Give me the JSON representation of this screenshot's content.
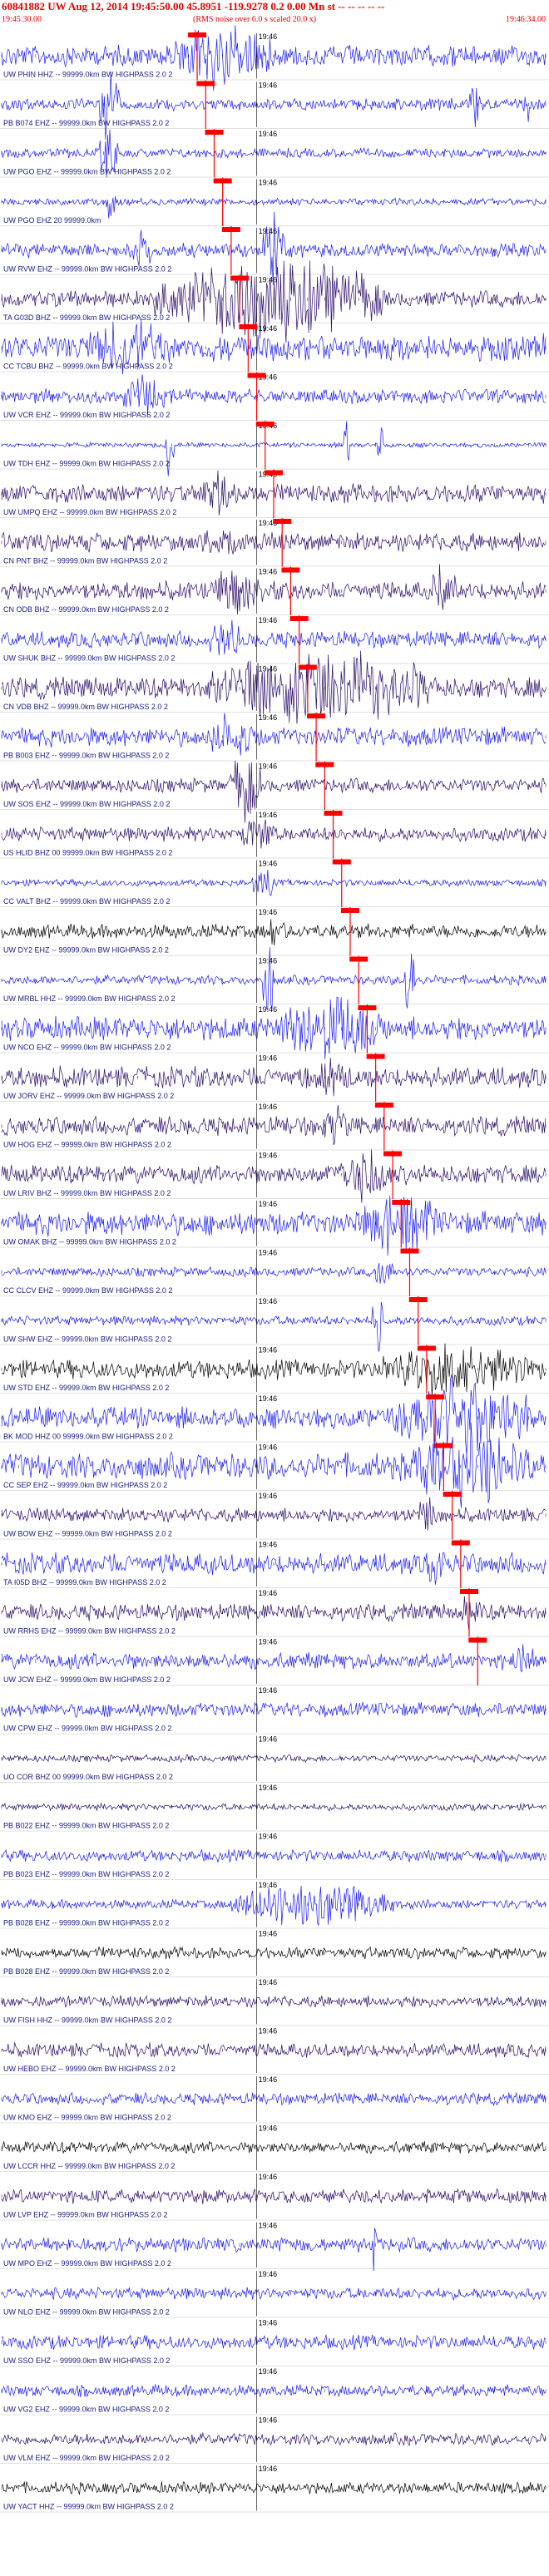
{
  "header": {
    "title": "60841882 UW Aug 12, 2014 19:45:50.00   45.8951 -119.9278  0.2 0.00 Mn st -- -- -- -- --",
    "start_time": "19:45:30.00",
    "scale_note": "(RMS noise over 6.0 s scaled 20.0 x)",
    "end_time": "19:46:34.00"
  },
  "colors": {
    "trace_blue": "#1a1aff",
    "trace_purple": "#2a0a6a",
    "trace_black": "#000000",
    "pick_red": "#ff0000",
    "label_dark": "#1a1a80"
  },
  "chart_data": {
    "type": "seismogram",
    "title": "60841882 UW Aug 12, 2014 19:45:50.00",
    "time_range": [
      "19:45:30.00",
      "19:46:34.00"
    ],
    "minute_tick_label": "19:46",
    "channels": [
      {
        "label": "UW PHIN HHZ -- 99999.0km BW  HIGHPASS  2.0  2",
        "color": "blue",
        "pick": "19:45:53",
        "amp": 0.45,
        "burst": [
          0.3,
          0.5,
          1.8
        ],
        "extra": []
      },
      {
        "label": "PB B074 EHZ -- 99999.0km BW  HIGHPASS  2.0  2",
        "color": "blue",
        "pick": "19:45:54",
        "amp": 0.25,
        "burst": [
          0.18,
          0.22,
          2.2
        ],
        "extra": [
          [
            0.86,
            0.88,
            2.0
          ],
          [
            0.96,
            0.97,
            1.6
          ]
        ]
      },
      {
        "label": "UW PGO EHZ -- 99999.0km BW  HIGHPASS  2.0  2",
        "color": "blue",
        "pick": "19:45:55",
        "amp": 0.2,
        "burst": [
          0.18,
          0.22,
          1.6
        ],
        "extra": []
      },
      {
        "label": "UW PGO EHZ 20 99999.0km",
        "color": "blue",
        "pick": "19:45:56",
        "amp": 0.15,
        "burst": [
          0.19,
          0.21,
          1.2
        ],
        "extra": []
      },
      {
        "label": "UW RVW EHZ -- 99999.0km BW  HIGHPASS  2.0  2",
        "color": "blue",
        "pick": "19:45:57",
        "amp": 0.3,
        "burst": [
          0.24,
          0.28,
          1.5
        ],
        "extra": [
          [
            0.48,
            0.52,
            2.0
          ]
        ]
      },
      {
        "label": "TA G03D BHZ -- 99999.0km BW  HIGHPASS  2.0  2",
        "color": "purple",
        "pick": "19:45:58",
        "amp": 0.35,
        "burst": [
          0.28,
          0.7,
          2.4
        ],
        "extra": []
      },
      {
        "label": "CC TCBU BHZ -- 99999.0km BW  HIGHPASS  2.0  2",
        "color": "blue",
        "pick": "19:45:59",
        "amp": 0.55,
        "burst": [
          0.15,
          0.32,
          1.6
        ],
        "extra": []
      },
      {
        "label": "UW VCR EHZ -- 99999.0km BW  HIGHPASS  2.0  2",
        "color": "blue",
        "pick": "19:46:00",
        "amp": 0.3,
        "burst": [
          0.22,
          0.3,
          1.2
        ],
        "extra": []
      },
      {
        "label": "UW TDH EHZ -- 99999.0km BW  HIGHPASS  2.0  2",
        "color": "blue",
        "pick": "19:46:01",
        "amp": 0.1,
        "burst": [
          0.3,
          0.32,
          2.5
        ],
        "extra": [
          [
            0.63,
            0.64,
            2.5
          ],
          [
            0.69,
            0.7,
            2.0
          ]
        ]
      },
      {
        "label": "UW UMPQ EHZ -- 99999.0km BW  HIGHPASS  2.0  2",
        "color": "purple",
        "pick": "19:46:02",
        "amp": 0.4,
        "burst": [
          0.36,
          0.44,
          1.2
        ],
        "extra": []
      },
      {
        "label": "CN PNT BHZ -- 99999.0km BW  HIGHPASS  2.0  2",
        "color": "purple",
        "pick": "19:46:03",
        "amp": 0.4,
        "burst": [
          0.36,
          0.46,
          1.2
        ],
        "extra": []
      },
      {
        "label": "CN ODB BHZ -- 99999.0km BW  HIGHPASS  2.0  2",
        "color": "purple",
        "pick": "19:46:04",
        "amp": 0.4,
        "burst": [
          0.38,
          0.48,
          1.4
        ],
        "extra": [
          [
            0.78,
            0.84,
            1.4
          ]
        ]
      },
      {
        "label": "UW SHUK BHZ -- 99999.0km BW  HIGHPASS  2.0  2",
        "color": "blue",
        "pick": "19:46:05",
        "amp": 0.35,
        "burst": [
          0.38,
          0.44,
          1.3
        ],
        "extra": []
      },
      {
        "label": "CN VDB BHZ -- 99999.0km BW  HIGHPASS  2.0  2",
        "color": "purple",
        "pick": "19:46:06",
        "amp": 0.45,
        "burst": [
          0.38,
          0.8,
          2.2
        ],
        "extra": []
      },
      {
        "label": "PB B003 EHZ -- 99999.0km BW  HIGHPASS  2.0  2",
        "color": "blue",
        "pick": "19:46:07",
        "amp": 0.4,
        "burst": [
          0.38,
          0.46,
          1.4
        ],
        "extra": []
      },
      {
        "label": "UW SOS EHZ -- 99999.0km BW  HIGHPASS  2.0  2",
        "color": "purple",
        "pick": "19:46:08",
        "amp": 0.3,
        "burst": [
          0.42,
          0.48,
          2.0
        ],
        "extra": []
      },
      {
        "label": "US HLID BHZ 00 99999.0km BW  HIGHPASS  2.0  2",
        "color": "purple",
        "pick": "19:46:09",
        "amp": 0.3,
        "burst": [
          0.44,
          0.5,
          1.2
        ],
        "extra": []
      },
      {
        "label": "CC VALT BHZ -- 99999.0km BW  HIGHPASS  2.0  2",
        "color": "blue",
        "pick": "19:46:10",
        "amp": 0.15,
        "burst": [
          0.46,
          0.5,
          1.0
        ],
        "extra": []
      },
      {
        "label": "UW DY2 EHZ -- 99999.0km BW  HIGHPASS  2.0  2",
        "color": "black",
        "pick": "19:46:11",
        "amp": 0.3,
        "burst": [
          0.48,
          0.52,
          1.2
        ],
        "extra": []
      },
      {
        "label": "UW MRBL HHZ -- 99999.0km BW  HIGHPASS  2.0  2",
        "color": "blue",
        "pick": "19:46:12",
        "amp": 0.2,
        "burst": [
          0.48,
          0.5,
          2.4
        ],
        "extra": [
          [
            0.74,
            0.76,
            2.4
          ]
        ]
      },
      {
        "label": "UW NCO EHZ -- 99999.0km BW  HIGHPASS  2.0  2",
        "color": "blue",
        "pick": "19:46:13",
        "amp": 0.5,
        "burst": [
          0.5,
          0.7,
          2.0
        ],
        "extra": []
      },
      {
        "label": "UW JORV EHZ -- 99999.0km BW  HIGHPASS  2.0  2",
        "color": "purple",
        "pick": "19:46:14",
        "amp": 0.45,
        "burst": [
          0.56,
          0.64,
          1.2
        ],
        "extra": []
      },
      {
        "label": "UW HOG EHZ -- 99999.0km BW  HIGHPASS  2.0  2",
        "color": "purple",
        "pick": "19:46:15",
        "amp": 0.4,
        "burst": [
          0.58,
          0.64,
          1.2
        ],
        "extra": []
      },
      {
        "label": "UW LRIV BHZ -- 99999.0km BW  HIGHPASS  2.0  2",
        "color": "purple",
        "pick": "19:46:16",
        "amp": 0.4,
        "burst": [
          0.6,
          0.72,
          1.6
        ],
        "extra": []
      },
      {
        "label": "UW OMAK BHZ -- 99999.0km BW  HIGHPASS  2.0  2",
        "color": "blue",
        "pick": "19:46:17",
        "amp": 0.5,
        "burst": [
          0.66,
          0.8,
          2.0
        ],
        "extra": []
      },
      {
        "label": "CC CLCV EHZ -- 99999.0km BW  HIGHPASS  2.0  2",
        "color": "blue",
        "pick": "19:46:18",
        "amp": 0.2,
        "burst": [
          0.68,
          0.72,
          1.0
        ],
        "extra": []
      },
      {
        "label": "UW SHW EHZ -- 99999.0km BW  HIGHPASS  2.0  2",
        "color": "blue",
        "pick": "19:46:19",
        "amp": 0.2,
        "burst": [
          0.68,
          0.7,
          2.0
        ],
        "extra": []
      },
      {
        "label": "UW STD EHZ -- 99999.0km BW  HIGHPASS  2.0  2",
        "color": "black",
        "pick": "19:46:20",
        "amp": 0.4,
        "burst": [
          0.7,
          0.98,
          1.6
        ],
        "extra": []
      },
      {
        "label": "BK MOD HHZ 00 99999.0km BW  HIGHPASS  2.0  2",
        "color": "blue",
        "pick": "19:46:21",
        "amp": 0.45,
        "burst": [
          0.72,
          0.98,
          2.4
        ],
        "extra": []
      },
      {
        "label": "CC SEP EHZ -- 99999.0km BW  HIGHPASS  2.0  2",
        "color": "blue",
        "pick": "19:46:22",
        "amp": 0.55,
        "burst": [
          0.74,
          0.98,
          2.2
        ],
        "extra": []
      },
      {
        "label": "UW BOW EHZ -- 99999.0km BW  HIGHPASS  2.0  2",
        "color": "purple",
        "pick": "19:46:23",
        "amp": 0.3,
        "burst": [
          0.76,
          0.8,
          1.2
        ],
        "extra": []
      },
      {
        "label": "TA I05D BHZ -- 99999.0km BW  HIGHPASS  2.0  2",
        "color": "blue",
        "pick": "19:46:24",
        "amp": 0.45,
        "burst": [
          0.78,
          0.82,
          1.5
        ],
        "extra": []
      },
      {
        "label": "UW RRHS EHZ -- 99999.0km BW  HIGHPASS  2.0  2",
        "color": "purple",
        "pick": "19:46:25",
        "amp": 0.35,
        "burst": [
          0.84,
          0.88,
          1.2
        ],
        "extra": []
      },
      {
        "label": "UW JCW EHZ -- 99999.0km BW  HIGHPASS  2.0  2",
        "color": "blue",
        "pick": "19:46:26",
        "amp": 0.35,
        "burst": [
          0.94,
          0.98,
          1.2
        ],
        "extra": []
      },
      {
        "label": "UW CPW EHZ -- 99999.0km BW  HIGHPASS  2.0  2",
        "color": "blue",
        "pick": "",
        "amp": 0.3,
        "burst": [],
        "extra": []
      },
      {
        "label": "UO COR BHZ 00 99999.0km BW  HIGHPASS  2.0  2",
        "color": "purple",
        "pick": "",
        "amp": 0.15,
        "burst": [],
        "extra": []
      },
      {
        "label": "PB B022 EHZ -- 99999.0km BW  HIGHPASS  2.0  2",
        "color": "purple",
        "pick": "",
        "amp": 0.15,
        "burst": [],
        "extra": []
      },
      {
        "label": "PB B023 EHZ -- 99999.0km BW  HIGHPASS  2.0  2",
        "color": "blue",
        "pick": "",
        "amp": 0.25,
        "burst": [],
        "extra": []
      },
      {
        "label": "PB B028 EHZ -- 99999.0km BW  HIGHPASS  2.0  2",
        "color": "blue",
        "pick": "",
        "amp": 0.2,
        "burst": [
          0.42,
          0.72,
          1.4
        ],
        "extra": []
      },
      {
        "label": "PB B028 EHZ -- 99999.0km BW  HIGHPASS  2.0  2",
        "color": "black",
        "pick": "",
        "amp": 0.25,
        "burst": [],
        "extra": []
      },
      {
        "label": "UW FISH HHZ -- 99999.0km BW  HIGHPASS  2.0  2",
        "color": "purple",
        "pick": "",
        "amp": 0.25,
        "burst": [],
        "extra": []
      },
      {
        "label": "UW HEBO EHZ -- 99999.0km BW  HIGHPASS  2.0  2",
        "color": "purple",
        "pick": "",
        "amp": 0.3,
        "burst": [],
        "extra": []
      },
      {
        "label": "UW KMO EHZ -- 99999.0km BW  HIGHPASS  2.0  2",
        "color": "blue",
        "pick": "",
        "amp": 0.25,
        "burst": [],
        "extra": []
      },
      {
        "label": "UW LCCR HHZ -- 99999.0km BW  HIGHPASS  2.0  2",
        "color": "black",
        "pick": "",
        "amp": 0.25,
        "burst": [],
        "extra": []
      },
      {
        "label": "UW LVP EHZ -- 99999.0km BW  HIGHPASS  2.0  2",
        "color": "purple",
        "pick": "",
        "amp": 0.3,
        "burst": [],
        "extra": []
      },
      {
        "label": "UW MPO EHZ -- 99999.0km BW  HIGHPASS  2.0  2",
        "color": "blue",
        "pick": "",
        "amp": 0.3,
        "burst": [],
        "extra": [
          [
            0.68,
            0.69,
            2.0
          ]
        ]
      },
      {
        "label": "UW NLO EHZ -- 99999.0km BW  HIGHPASS  2.0  2",
        "color": "blue",
        "pick": "",
        "amp": 0.25,
        "burst": [],
        "extra": []
      },
      {
        "label": "UW SSO EHZ -- 99999.0km BW  HIGHPASS  2.0  2",
        "color": "blue",
        "pick": "",
        "amp": 0.3,
        "burst": [],
        "extra": []
      },
      {
        "label": "UW VG2 EHZ -- 99999.0km BW  HIGHPASS  2.0  2",
        "color": "blue",
        "pick": "",
        "amp": 0.25,
        "burst": [],
        "extra": []
      },
      {
        "label": "UW VLM EHZ -- 99999.0km BW  HIGHPASS  2.0  2",
        "color": "purple",
        "pick": "",
        "amp": 0.25,
        "burst": [],
        "extra": []
      },
      {
        "label": "UW YACT HHZ -- 99999.0km BW  HIGHPASS  2.0  2",
        "color": "black",
        "pick": "",
        "amp": 0.25,
        "burst": [],
        "extra": []
      }
    ]
  }
}
